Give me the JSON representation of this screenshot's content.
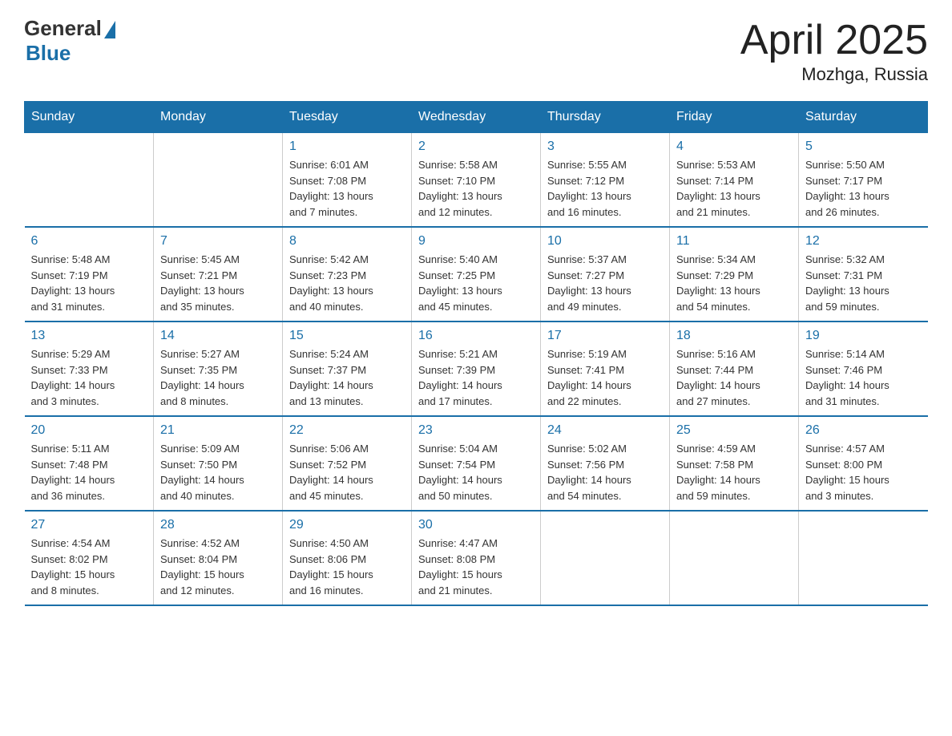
{
  "logo": {
    "general": "General",
    "blue": "Blue",
    "tagline": "Blue"
  },
  "title": "April 2025",
  "subtitle": "Mozhga, Russia",
  "days_of_week": [
    "Sunday",
    "Monday",
    "Tuesday",
    "Wednesday",
    "Thursday",
    "Friday",
    "Saturday"
  ],
  "weeks": [
    [
      {
        "day": "",
        "info": ""
      },
      {
        "day": "",
        "info": ""
      },
      {
        "day": "1",
        "info": "Sunrise: 6:01 AM\nSunset: 7:08 PM\nDaylight: 13 hours\nand 7 minutes."
      },
      {
        "day": "2",
        "info": "Sunrise: 5:58 AM\nSunset: 7:10 PM\nDaylight: 13 hours\nand 12 minutes."
      },
      {
        "day": "3",
        "info": "Sunrise: 5:55 AM\nSunset: 7:12 PM\nDaylight: 13 hours\nand 16 minutes."
      },
      {
        "day": "4",
        "info": "Sunrise: 5:53 AM\nSunset: 7:14 PM\nDaylight: 13 hours\nand 21 minutes."
      },
      {
        "day": "5",
        "info": "Sunrise: 5:50 AM\nSunset: 7:17 PM\nDaylight: 13 hours\nand 26 minutes."
      }
    ],
    [
      {
        "day": "6",
        "info": "Sunrise: 5:48 AM\nSunset: 7:19 PM\nDaylight: 13 hours\nand 31 minutes."
      },
      {
        "day": "7",
        "info": "Sunrise: 5:45 AM\nSunset: 7:21 PM\nDaylight: 13 hours\nand 35 minutes."
      },
      {
        "day": "8",
        "info": "Sunrise: 5:42 AM\nSunset: 7:23 PM\nDaylight: 13 hours\nand 40 minutes."
      },
      {
        "day": "9",
        "info": "Sunrise: 5:40 AM\nSunset: 7:25 PM\nDaylight: 13 hours\nand 45 minutes."
      },
      {
        "day": "10",
        "info": "Sunrise: 5:37 AM\nSunset: 7:27 PM\nDaylight: 13 hours\nand 49 minutes."
      },
      {
        "day": "11",
        "info": "Sunrise: 5:34 AM\nSunset: 7:29 PM\nDaylight: 13 hours\nand 54 minutes."
      },
      {
        "day": "12",
        "info": "Sunrise: 5:32 AM\nSunset: 7:31 PM\nDaylight: 13 hours\nand 59 minutes."
      }
    ],
    [
      {
        "day": "13",
        "info": "Sunrise: 5:29 AM\nSunset: 7:33 PM\nDaylight: 14 hours\nand 3 minutes."
      },
      {
        "day": "14",
        "info": "Sunrise: 5:27 AM\nSunset: 7:35 PM\nDaylight: 14 hours\nand 8 minutes."
      },
      {
        "day": "15",
        "info": "Sunrise: 5:24 AM\nSunset: 7:37 PM\nDaylight: 14 hours\nand 13 minutes."
      },
      {
        "day": "16",
        "info": "Sunrise: 5:21 AM\nSunset: 7:39 PM\nDaylight: 14 hours\nand 17 minutes."
      },
      {
        "day": "17",
        "info": "Sunrise: 5:19 AM\nSunset: 7:41 PM\nDaylight: 14 hours\nand 22 minutes."
      },
      {
        "day": "18",
        "info": "Sunrise: 5:16 AM\nSunset: 7:44 PM\nDaylight: 14 hours\nand 27 minutes."
      },
      {
        "day": "19",
        "info": "Sunrise: 5:14 AM\nSunset: 7:46 PM\nDaylight: 14 hours\nand 31 minutes."
      }
    ],
    [
      {
        "day": "20",
        "info": "Sunrise: 5:11 AM\nSunset: 7:48 PM\nDaylight: 14 hours\nand 36 minutes."
      },
      {
        "day": "21",
        "info": "Sunrise: 5:09 AM\nSunset: 7:50 PM\nDaylight: 14 hours\nand 40 minutes."
      },
      {
        "day": "22",
        "info": "Sunrise: 5:06 AM\nSunset: 7:52 PM\nDaylight: 14 hours\nand 45 minutes."
      },
      {
        "day": "23",
        "info": "Sunrise: 5:04 AM\nSunset: 7:54 PM\nDaylight: 14 hours\nand 50 minutes."
      },
      {
        "day": "24",
        "info": "Sunrise: 5:02 AM\nSunset: 7:56 PM\nDaylight: 14 hours\nand 54 minutes."
      },
      {
        "day": "25",
        "info": "Sunrise: 4:59 AM\nSunset: 7:58 PM\nDaylight: 14 hours\nand 59 minutes."
      },
      {
        "day": "26",
        "info": "Sunrise: 4:57 AM\nSunset: 8:00 PM\nDaylight: 15 hours\nand 3 minutes."
      }
    ],
    [
      {
        "day": "27",
        "info": "Sunrise: 4:54 AM\nSunset: 8:02 PM\nDaylight: 15 hours\nand 8 minutes."
      },
      {
        "day": "28",
        "info": "Sunrise: 4:52 AM\nSunset: 8:04 PM\nDaylight: 15 hours\nand 12 minutes."
      },
      {
        "day": "29",
        "info": "Sunrise: 4:50 AM\nSunset: 8:06 PM\nDaylight: 15 hours\nand 16 minutes."
      },
      {
        "day": "30",
        "info": "Sunrise: 4:47 AM\nSunset: 8:08 PM\nDaylight: 15 hours\nand 21 minutes."
      },
      {
        "day": "",
        "info": ""
      },
      {
        "day": "",
        "info": ""
      },
      {
        "day": "",
        "info": ""
      }
    ]
  ]
}
